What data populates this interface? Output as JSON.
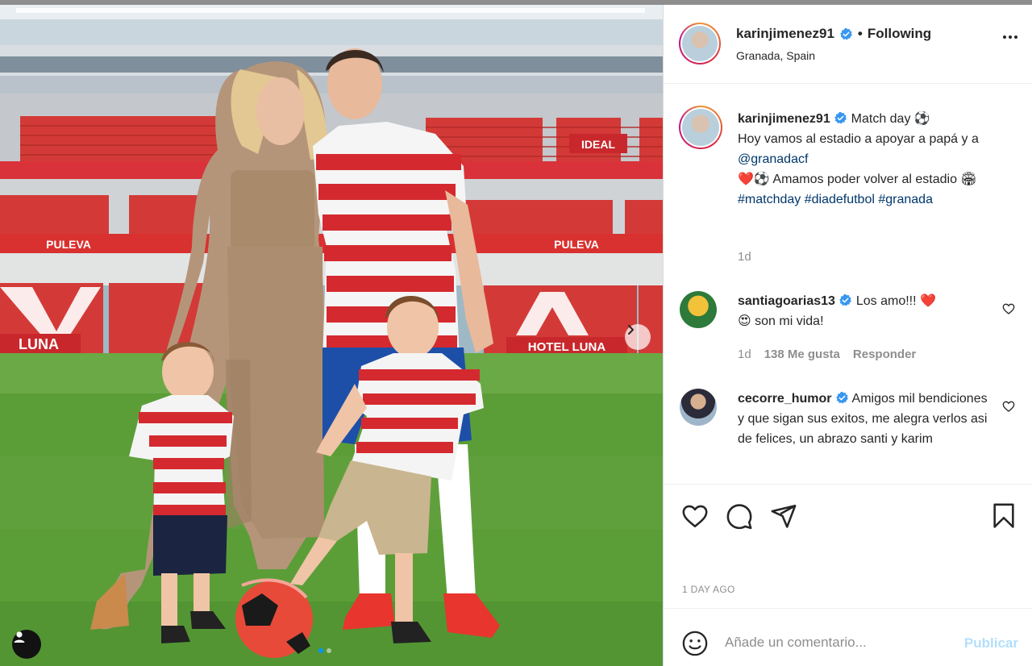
{
  "post": {
    "username": "karinjimenez91",
    "separator": "•",
    "follow_status": "Following",
    "location": "Granada, Spain",
    "time_ago": "1 DAY AGO"
  },
  "photo": {
    "stadium_signs": [
      "IDEAL",
      "PULEVA",
      "PULEVA",
      "HOTEL LUNA",
      "LUNA"
    ],
    "carousel_count": 2,
    "carousel_active": 0
  },
  "caption": {
    "username": "karinjimenez91",
    "line1": "Match day ⚽",
    "line2": "Hoy vamos al estadio a apoyar a papá y a",
    "mention": "@granadacf",
    "line3_emoji": "❤️⚽",
    "line3": "Amamos poder volver al estadio 🏟",
    "hashtags": [
      "#matchday",
      "#diadefutbol",
      "#granada"
    ],
    "time": "1d"
  },
  "comments": [
    {
      "username": "santiagoarias13",
      "text1": "Los amo!!!",
      "emoji1": "❤️",
      "emoji2": "😍",
      "text2": "son mi vida!",
      "time": "1d",
      "likes": "138 Me gusta",
      "reply": "Responder"
    },
    {
      "username": "cecorre_humor",
      "text": "Amigos mil bendiciones y que sigan sus exitos, me alegra verlos asi de felices, un abrazo santi y karim"
    }
  ],
  "comment_box": {
    "placeholder": "Añade un comentario...",
    "publish": "Publicar"
  },
  "colors": {
    "link": "#00376b",
    "verified": "#3897f0",
    "secondary": "#8e8e8e",
    "publish_disabled": "#b2dffc",
    "jersey_red": "#d42a2f"
  },
  "icons": [
    "verified-badge-icon",
    "more-options-icon",
    "heart-icon",
    "comment-icon",
    "share-icon",
    "bookmark-icon",
    "emoji-icon",
    "user-tag-icon",
    "chevron-right-icon"
  ]
}
